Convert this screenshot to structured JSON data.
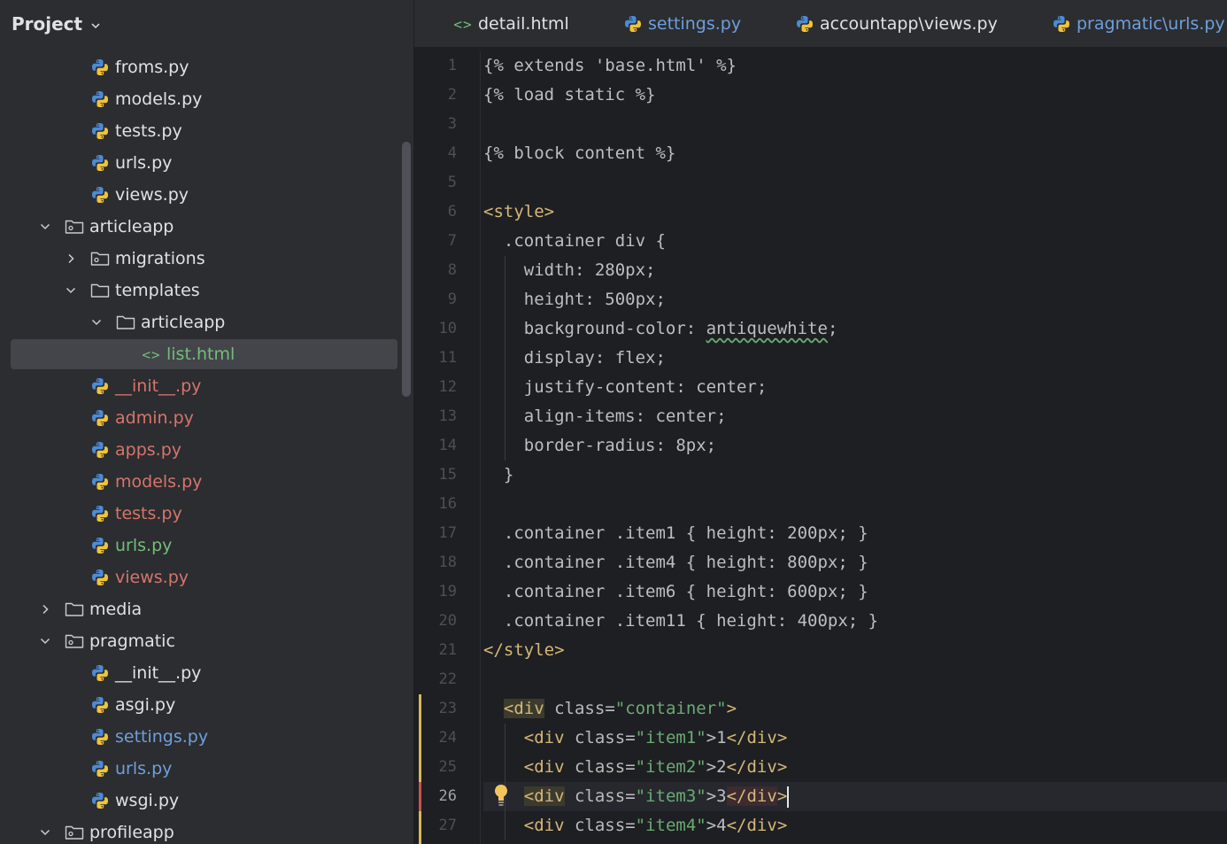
{
  "project": {
    "title": "Project",
    "tree": [
      {
        "label": "froms.py",
        "icon": "python-file-icon",
        "state": "default",
        "arrow": "none",
        "depth": 3
      },
      {
        "label": "models.py",
        "icon": "python-file-icon",
        "state": "default",
        "arrow": "none",
        "depth": 3
      },
      {
        "label": "tests.py",
        "icon": "python-file-icon",
        "state": "default",
        "arrow": "none",
        "depth": 3
      },
      {
        "label": "urls.py",
        "icon": "python-file-icon",
        "state": "default",
        "arrow": "none",
        "depth": 3
      },
      {
        "label": "views.py",
        "icon": "python-file-icon",
        "state": "default",
        "arrow": "none",
        "depth": 3
      },
      {
        "label": "articleapp",
        "icon": "package-folder-icon",
        "state": "default",
        "arrow": "expanded",
        "depth": 2
      },
      {
        "label": "migrations",
        "icon": "package-folder-icon",
        "state": "default",
        "arrow": "collapsed",
        "depth": 3
      },
      {
        "label": "templates",
        "icon": "folder-icon",
        "state": "default",
        "arrow": "expanded",
        "depth": 3
      },
      {
        "label": "articleapp",
        "icon": "folder-icon",
        "state": "default",
        "arrow": "expanded",
        "depth": 4
      },
      {
        "label": "list.html",
        "icon": "html-file-icon",
        "state": "green",
        "arrow": "none",
        "depth": 5,
        "selected": true
      },
      {
        "label": "__init__.py",
        "icon": "python-file-icon",
        "state": "modified",
        "arrow": "none",
        "depth": 3
      },
      {
        "label": "admin.py",
        "icon": "python-file-icon",
        "state": "modified",
        "arrow": "none",
        "depth": 3
      },
      {
        "label": "apps.py",
        "icon": "python-file-icon",
        "state": "modified",
        "arrow": "none",
        "depth": 3
      },
      {
        "label": "models.py",
        "icon": "python-file-icon",
        "state": "modified",
        "arrow": "none",
        "depth": 3
      },
      {
        "label": "tests.py",
        "icon": "python-file-icon",
        "state": "modified",
        "arrow": "none",
        "depth": 3
      },
      {
        "label": "urls.py",
        "icon": "python-file-icon",
        "state": "added",
        "arrow": "none",
        "depth": 3
      },
      {
        "label": "views.py",
        "icon": "python-file-icon",
        "state": "modified",
        "arrow": "none",
        "depth": 3
      },
      {
        "label": "media",
        "icon": "folder-icon",
        "state": "default",
        "arrow": "collapsed",
        "depth": 2
      },
      {
        "label": "pragmatic",
        "icon": "package-folder-icon",
        "state": "default",
        "arrow": "expanded",
        "depth": 2
      },
      {
        "label": "__init__.py",
        "icon": "python-file-icon",
        "state": "default",
        "arrow": "none",
        "depth": 3
      },
      {
        "label": "asgi.py",
        "icon": "python-file-icon",
        "state": "default",
        "arrow": "none",
        "depth": 3
      },
      {
        "label": "settings.py",
        "icon": "python-file-icon",
        "state": "blue",
        "arrow": "none",
        "depth": 3
      },
      {
        "label": "urls.py",
        "icon": "python-file-icon",
        "state": "blue",
        "arrow": "none",
        "depth": 3
      },
      {
        "label": "wsgi.py",
        "icon": "python-file-icon",
        "state": "default",
        "arrow": "none",
        "depth": 3
      },
      {
        "label": "profileapp",
        "icon": "package-folder-icon",
        "state": "default",
        "arrow": "expanded",
        "depth": 2
      }
    ]
  },
  "tabs": [
    {
      "label": "detail.html",
      "icon": "html-file-icon",
      "state": "default"
    },
    {
      "label": "settings.py",
      "icon": "python-file-icon",
      "state": "blue"
    },
    {
      "label": "accountapp\\views.py",
      "icon": "python-file-icon",
      "state": "default"
    },
    {
      "label": "pragmatic\\urls.py",
      "icon": "python-file-icon",
      "state": "blue"
    }
  ],
  "editor": {
    "current_line": 26,
    "lines": [
      {
        "n": "1",
        "text": "{% extends 'base.html' %}"
      },
      {
        "n": "2",
        "text": "{% load static %}"
      },
      {
        "n": "3",
        "text": ""
      },
      {
        "n": "4",
        "text": "{% block content %}"
      },
      {
        "n": "5",
        "text": ""
      },
      {
        "n": "6",
        "text": "<style>"
      },
      {
        "n": "7",
        "text": "  .container div {"
      },
      {
        "n": "8",
        "text": "    width: 280px;"
      },
      {
        "n": "9",
        "text": "    height: 500px;"
      },
      {
        "n": "10",
        "text": "    background-color: antiquewhite;"
      },
      {
        "n": "11",
        "text": "    display: flex;"
      },
      {
        "n": "12",
        "text": "    justify-content: center;"
      },
      {
        "n": "13",
        "text": "    align-items: center;"
      },
      {
        "n": "14",
        "text": "    border-radius: 8px;"
      },
      {
        "n": "15",
        "text": "  }"
      },
      {
        "n": "16",
        "text": ""
      },
      {
        "n": "17",
        "text": "  .container .item1 { height: 200px; }"
      },
      {
        "n": "18",
        "text": "  .container .item4 { height: 800px; }"
      },
      {
        "n": "19",
        "text": "  .container .item6 { height: 600px; }"
      },
      {
        "n": "20",
        "text": "  .container .item11 { height: 400px; }"
      },
      {
        "n": "21",
        "text": "</style>"
      },
      {
        "n": "22",
        "text": ""
      },
      {
        "n": "23",
        "text": "  <div class=\"container\">"
      },
      {
        "n": "24",
        "text": "    <div class=\"item1\">1</div>"
      },
      {
        "n": "25",
        "text": "    <div class=\"item2\">2</div>"
      },
      {
        "n": "26",
        "text": "    <div class=\"item3\">3</div>"
      },
      {
        "n": "27",
        "text": "    <div class=\"item4\">4</div>"
      }
    ]
  },
  "colors": {
    "panel_bg": "#2b2d30",
    "editor_bg": "#1e1f22",
    "modified": "#d5756c",
    "added": "#73bd79",
    "blue": "#6f9fdc",
    "tag": "#d5b778",
    "string": "#6aab73"
  }
}
